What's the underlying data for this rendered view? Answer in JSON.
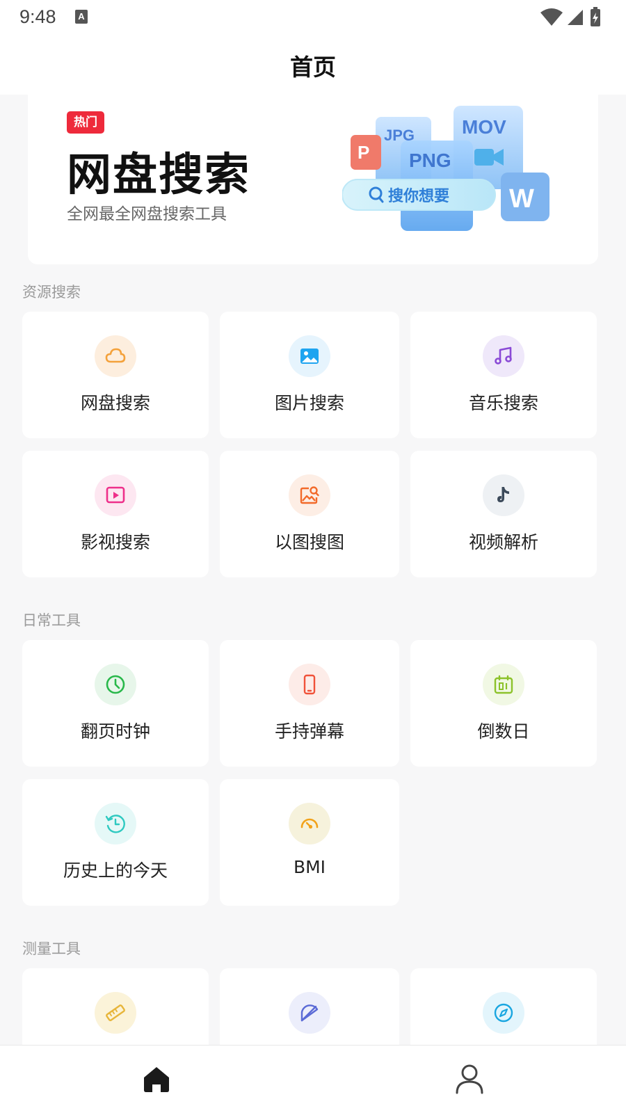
{
  "status_bar": {
    "time": "9:48",
    "notification_icon_letter": "A",
    "icons": [
      "wifi-icon",
      "signal-icon",
      "battery-charging-icon"
    ]
  },
  "header": {
    "title": "首页"
  },
  "banner": {
    "badge": "热门",
    "title": "网盘搜索",
    "subtitle": "全网最全网盘搜索工具",
    "art": {
      "tiles": [
        "P",
        "JPG",
        "PNG",
        "MOV",
        "W"
      ],
      "search_pill": "搜你想要"
    }
  },
  "sections": [
    {
      "title": "资源搜索",
      "items": [
        {
          "label": "网盘搜索",
          "icon": "cloud-icon",
          "color": "#f4a13a",
          "bg": "#fdeede"
        },
        {
          "label": "图片搜索",
          "icon": "image-icon",
          "color": "#1ea4f0",
          "bg": "#e6f4fd"
        },
        {
          "label": "音乐搜索",
          "icon": "music-note-icon",
          "color": "#8a4ad6",
          "bg": "#efe8fa"
        },
        {
          "label": "影视搜索",
          "icon": "play-screen-icon",
          "color": "#ee2f8a",
          "bg": "#fde7f1"
        },
        {
          "label": "以图搜图",
          "icon": "image-search-icon",
          "color": "#f26a2a",
          "bg": "#fdeee5"
        },
        {
          "label": "视频解析",
          "icon": "tiktok-icon",
          "color": "#3c4a5a",
          "bg": "#eef1f4"
        }
      ]
    },
    {
      "title": "日常工具",
      "items": [
        {
          "label": "翻页时钟",
          "icon": "clock-icon",
          "color": "#28b84a",
          "bg": "#e7f6ea"
        },
        {
          "label": "手持弹幕",
          "icon": "phone-icon",
          "color": "#f0523a",
          "bg": "#fdece8"
        },
        {
          "label": "倒数日",
          "icon": "calendar-icon",
          "color": "#8cc22a",
          "bg": "#f1f8e4"
        },
        {
          "label": "历史上的今天",
          "icon": "history-clock-icon",
          "color": "#2ec9c0",
          "bg": "#e5f8f7"
        },
        {
          "label": "BMI",
          "icon": "gauge-icon",
          "color": "#f2a21a",
          "bg": "#f6f2dc"
        }
      ]
    },
    {
      "title": "测量工具",
      "items": [
        {
          "label": "",
          "icon": "ruler-icon",
          "color": "#e7b53a",
          "bg": "#fbf3d9"
        },
        {
          "label": "",
          "icon": "protractor-icon",
          "color": "#5a6ad6",
          "bg": "#eceefb"
        },
        {
          "label": "",
          "icon": "compass-icon",
          "color": "#1aa6e0",
          "bg": "#e3f5fc"
        }
      ]
    }
  ],
  "tab_bar": {
    "tabs": [
      {
        "name": "home",
        "icon": "home-icon",
        "active": true
      },
      {
        "name": "profile",
        "icon": "user-icon",
        "active": false
      }
    ]
  }
}
